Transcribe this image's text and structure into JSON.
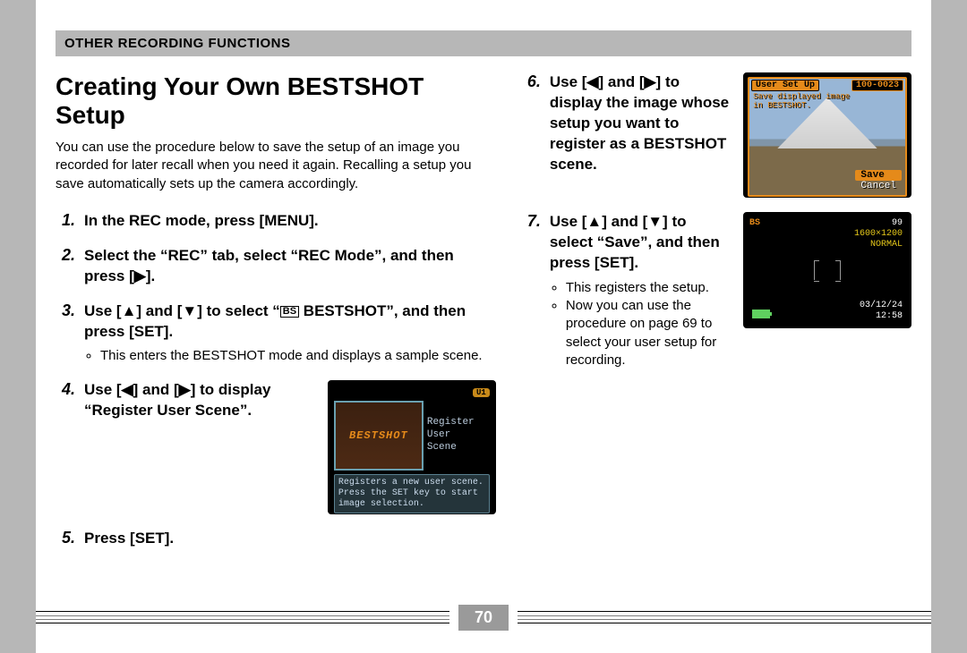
{
  "header": {
    "section": "OTHER RECORDING FUNCTIONS"
  },
  "title": "Creating Your Own BESTSHOT Setup",
  "intro": "You can use the procedure below to save the setup of an image you recorded for later recall when you need it again. Recalling a setup you save automatically sets up the camera accordingly.",
  "steps": {
    "s1": {
      "num": "1.",
      "text": "In the REC mode, press [MENU]."
    },
    "s2": {
      "num": "2.",
      "text": "Select the “REC” tab, select “REC Mode”, and then press [▶]."
    },
    "s3": {
      "num": "3.",
      "text_a": "Use [▲] and [▼] to select “",
      "text_b": " BESTSHOT”, and then press [SET].",
      "bullets": [
        "This enters the BESTSHOT mode and displays a sample scene."
      ]
    },
    "s4": {
      "num": "4.",
      "text": "Use [◀] and [▶] to display “Register User Scene”."
    },
    "s5": {
      "num": "5.",
      "text": "Press [SET]."
    },
    "s6": {
      "num": "6.",
      "text": "Use [◀] and [▶] to display the image whose setup you want to register as a BESTSHOT scene."
    },
    "s7": {
      "num": "7.",
      "text": "Use [▲] and [▼] to select “Save”, and then press [SET].",
      "bullets": [
        "This registers the setup.",
        "Now you can use the procedure on page 69 to select your user setup for recording."
      ]
    }
  },
  "lcd1": {
    "badge": "U1",
    "brand": "BESTSHOT",
    "menu1": "Register",
    "menu2": "User",
    "menu3": "Scene",
    "desc": "Registers a new user scene. Press the SET key to start image selection."
  },
  "lcd2": {
    "tl": "User Set Up",
    "tr": "100-0023",
    "sub": "Save displayed image\nin BESTSHOT.",
    "save": "Save",
    "cancel": "Cancel"
  },
  "lcd3": {
    "bs": "BS",
    "count": "99",
    "res": "1600×1200",
    "qual": "NORMAL",
    "date": "03/12/24",
    "time": "12:58"
  },
  "bs_icon": "BS",
  "page_number": "70"
}
